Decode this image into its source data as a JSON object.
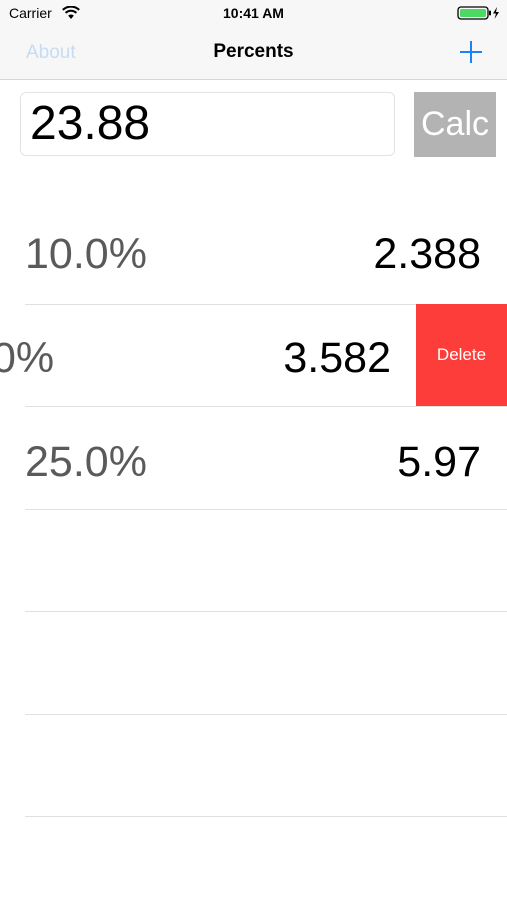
{
  "status_bar": {
    "carrier": "Carrier",
    "time": "10:41 AM",
    "wifi_icon": "wifi-icon",
    "battery_icon": "battery-charging-icon"
  },
  "nav_bar": {
    "left_button": "About",
    "title": "Percents",
    "right_icon": "plus-icon"
  },
  "input": {
    "amount": "23.88"
  },
  "calc_button": {
    "label": "Calc"
  },
  "rows": [
    {
      "percent": "10.0%",
      "value": "2.388"
    },
    {
      "percent": "0%",
      "value": "3.582",
      "swipe_action": "Delete"
    },
    {
      "percent": "25.0%",
      "value": "5.97"
    }
  ],
  "colors": {
    "tint": "#1a82fb",
    "delete": "#fc3d39",
    "calc_disabled": "#b3b3b3",
    "about_disabled": "#c7dbf3"
  }
}
